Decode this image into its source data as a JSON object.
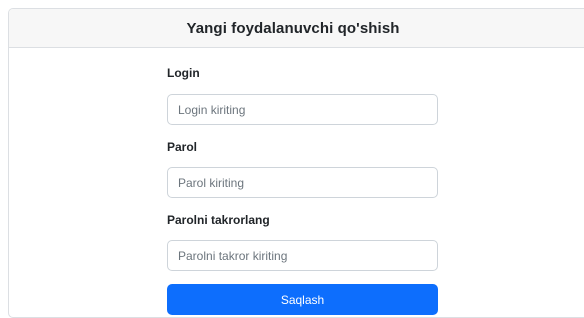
{
  "header": {
    "title": "Yangi foydalanuvchi qo'shish"
  },
  "form": {
    "login": {
      "label": "Login",
      "placeholder": "Login kiriting",
      "value": ""
    },
    "password": {
      "label": "Parol",
      "placeholder": "Parol kiriting",
      "value": ""
    },
    "password_repeat": {
      "label": "Parolni takrorlang",
      "placeholder": "Parolni takror kiriting",
      "value": ""
    },
    "save_label": "Saqlash"
  },
  "colors": {
    "primary": "#0d6efd",
    "header_bg": "#f7f7f7",
    "border": "#dcdfe3"
  }
}
